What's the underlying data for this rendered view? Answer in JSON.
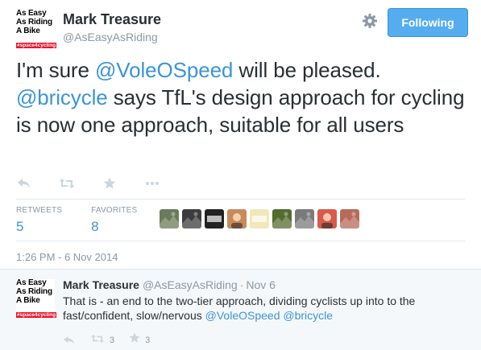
{
  "tweet": {
    "avatar": {
      "lines": [
        "As Easy",
        "As Riding",
        "A Bike"
      ],
      "tag": "#space4cycling"
    },
    "author_name": "Mark Treasure",
    "author_handle": "@AsEasyAsRiding",
    "follow_label": "Following",
    "text_parts": [
      "I'm sure ",
      "@VoleOSpeed",
      " will be pleased. ",
      "@bricycle",
      " says TfL's design approach for cycling is now one approach, suitable for all users"
    ],
    "stats": {
      "retweets_label": "RETWEETS",
      "retweets_value": "5",
      "favorites_label": "FAVORITES",
      "favorites_value": "8"
    },
    "timestamp": "1:26 PM - 6 Nov 2014"
  },
  "favoriters": [
    {
      "icon": "photo-avatar",
      "color": "#6b7a5a"
    },
    {
      "icon": "photo-avatar",
      "color": "#3c3c3c"
    },
    {
      "icon": "logo-avatar",
      "color": "#222222",
      "label": "TDE"
    },
    {
      "icon": "person-avatar",
      "color": "#c88a5a"
    },
    {
      "icon": "logo-avatar",
      "color": "#f1e7b8",
      "label": "#space4cycling"
    },
    {
      "icon": "photo-avatar",
      "color": "#556b2f"
    },
    {
      "icon": "photo-avatar",
      "color": "#7a7a7a"
    },
    {
      "icon": "person-avatar",
      "color": "#d65b4a"
    },
    {
      "icon": "photo-avatar",
      "color": "#b86a5a"
    }
  ],
  "reply": {
    "avatar": {
      "lines": [
        "As Easy",
        "As Riding",
        "A Bike"
      ],
      "tag": "#space4cycling"
    },
    "author_name": "Mark Treasure",
    "author_handle": "@AsEasyAsRiding",
    "separator": "·",
    "time": "Nov 6",
    "text_parts": [
      "That is - an end to the two-tier approach, dividing cyclists up into to the fast/confident, slow/nervous ",
      "@VoleOSpeed",
      " ",
      "@bricycle"
    ],
    "retweet_count": "3",
    "favorite_count": "3"
  },
  "colors": {
    "accent": "#55acee",
    "link": "#3b94d9",
    "muted": "#8899a6",
    "logo_tag": "#e8132b"
  }
}
